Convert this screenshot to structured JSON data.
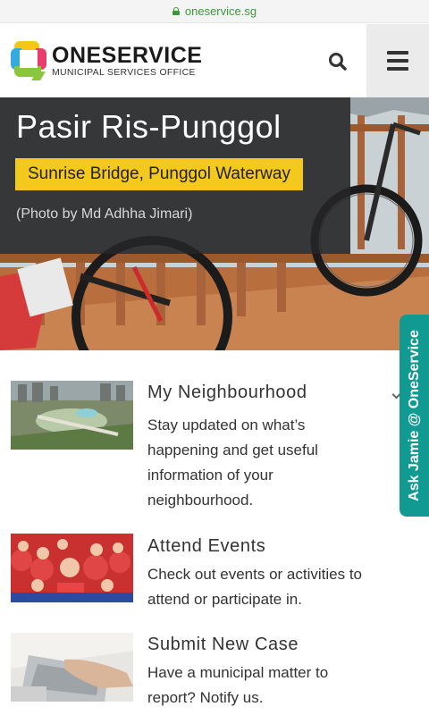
{
  "browser": {
    "url": "oneservice.sg"
  },
  "header": {
    "logo_name": "ONESERVICE",
    "logo_subtitle": "MUNICIPAL SERVICES OFFICE",
    "search_icon": "search-icon",
    "menu_icon": "hamburger-icon"
  },
  "hero": {
    "title": "Pasir Ris-Punggol",
    "location": "Sunrise Bridge, Punggol Waterway",
    "credit": "(Photo by Md Adhha Jimari)"
  },
  "features": [
    {
      "title": "My Neighbourhood",
      "description": "Stay updated on what’s happening and get useful information of your neighbourhood."
    },
    {
      "title": "Attend Events",
      "description": "Check out events or activities to attend or participate in."
    },
    {
      "title": "Submit New Case",
      "description": "Have a municipal matter to report? Notify us."
    }
  ],
  "side_tab": {
    "label": "Ask Jamie @ OneService"
  },
  "colors": {
    "accent_yellow": "#f3c91e",
    "teal": "#109a92",
    "url_green": "#3a9a3a"
  }
}
